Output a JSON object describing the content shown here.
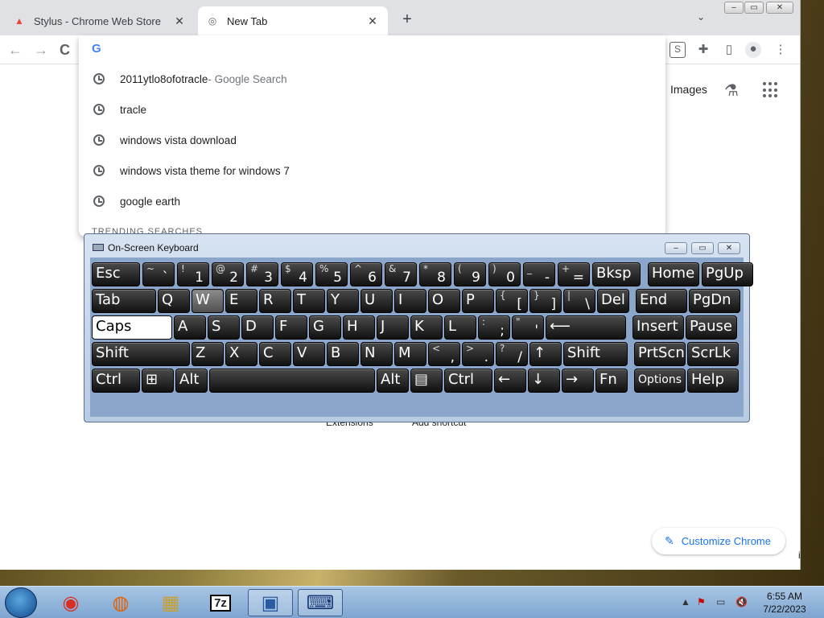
{
  "browser": {
    "tabs": [
      {
        "title": "Stylus - Chrome Web Store",
        "active": false
      },
      {
        "title": "New Tab",
        "active": true
      }
    ],
    "new_tab_glyph": "+",
    "tab_search_glyph": "⌄",
    "window_controls": {
      "min": "–",
      "max": "▭",
      "close": "✕"
    },
    "nav": {
      "back": "←",
      "forward": "→",
      "reload": "C"
    },
    "toolbar_icons": [
      "stylus-extension-icon",
      "extensions-icon",
      "side-panel-icon",
      "profile-icon",
      "menu-icon"
    ]
  },
  "omnibox": {
    "input_value": "",
    "suggestions": [
      {
        "text": "2011ytlo8ofotracle",
        "sub": " - Google Search"
      },
      {
        "text": "tracle",
        "sub": ""
      },
      {
        "text": "windows vista download",
        "sub": ""
      },
      {
        "text": "windows vista theme for windows 7",
        "sub": ""
      },
      {
        "text": "google earth",
        "sub": ""
      }
    ],
    "trending_label": "TRENDING SEARCHES"
  },
  "ntp": {
    "images_link": "Images",
    "extensions_label": "Extensions",
    "add_shortcut_label": "Add shortcut",
    "customize_label": "Customize Chrome",
    "partial_in": "in"
  },
  "osk": {
    "title": "On-Screen Keyboard",
    "rows": [
      [
        {
          "l": "Esc"
        },
        {
          "t": "~",
          "b": "`"
        },
        {
          "t": "!",
          "b": "1"
        },
        {
          "t": "@",
          "b": "2"
        },
        {
          "t": "#",
          "b": "3"
        },
        {
          "t": "$",
          "b": "4"
        },
        {
          "t": "%",
          "b": "5"
        },
        {
          "t": "^",
          "b": "6"
        },
        {
          "t": "&",
          "b": "7"
        },
        {
          "t": "*",
          "b": "8"
        },
        {
          "t": "(",
          "b": "9"
        },
        {
          "t": ")",
          "b": "0"
        },
        {
          "t": "_",
          "b": "-"
        },
        {
          "t": "+",
          "b": "="
        },
        {
          "l": "Bksp"
        },
        {
          "l": "Home"
        },
        {
          "l": "PgUp"
        }
      ],
      [
        {
          "l": "Tab"
        },
        {
          "l": "Q"
        },
        {
          "l": "W"
        },
        {
          "l": "E"
        },
        {
          "l": "R"
        },
        {
          "l": "T"
        },
        {
          "l": "Y"
        },
        {
          "l": "U"
        },
        {
          "l": "I"
        },
        {
          "l": "O"
        },
        {
          "l": "P"
        },
        {
          "t": "{",
          "b": "["
        },
        {
          "t": "}",
          "b": "]"
        },
        {
          "t": "|",
          "b": "\\"
        },
        {
          "l": "Del"
        },
        {
          "l": "End"
        },
        {
          "l": "PgDn"
        }
      ],
      [
        {
          "l": "Caps"
        },
        {
          "l": "A"
        },
        {
          "l": "S"
        },
        {
          "l": "D"
        },
        {
          "l": "F"
        },
        {
          "l": "G"
        },
        {
          "l": "H"
        },
        {
          "l": "J"
        },
        {
          "l": "K"
        },
        {
          "l": "L"
        },
        {
          "t": ":",
          "b": ";"
        },
        {
          "t": "\"",
          "b": "'"
        },
        {
          "l": "⟵"
        },
        {
          "l": "Insert"
        },
        {
          "l": "Pause"
        }
      ],
      [
        {
          "l": "Shift"
        },
        {
          "l": "Z"
        },
        {
          "l": "X"
        },
        {
          "l": "C"
        },
        {
          "l": "V"
        },
        {
          "l": "B"
        },
        {
          "l": "N"
        },
        {
          "l": "M"
        },
        {
          "t": "<",
          "b": ","
        },
        {
          "t": ">",
          "b": "."
        },
        {
          "t": "?",
          "b": "/"
        },
        {
          "l": "↑"
        },
        {
          "l": "Shift"
        },
        {
          "l": "PrtScn"
        },
        {
          "l": "ScrLk"
        }
      ],
      [
        {
          "l": "Ctrl"
        },
        {
          "l": "⊞"
        },
        {
          "l": "Alt"
        },
        {
          "l": ""
        },
        {
          "l": "Alt"
        },
        {
          "l": "▤"
        },
        {
          "l": "Ctrl"
        },
        {
          "l": "←"
        },
        {
          "l": "↓"
        },
        {
          "l": "→"
        },
        {
          "l": "Fn"
        },
        {
          "l": "Options"
        },
        {
          "l": "Help"
        }
      ]
    ]
  },
  "taskbar": {
    "apps": [
      "chrome-icon",
      "firefox-icon",
      "explorer-icon",
      "7zip-icon",
      "control-panel-icon",
      "on-screen-keyboard-icon"
    ],
    "app_glyphs": [
      "◉",
      "◍",
      "▦",
      "7z",
      "▣",
      "⌨"
    ],
    "tray_glyphs": [
      "▲",
      "⚑",
      "▭",
      "🔇"
    ],
    "time": "6:55 AM",
    "date": "7/22/2023"
  }
}
